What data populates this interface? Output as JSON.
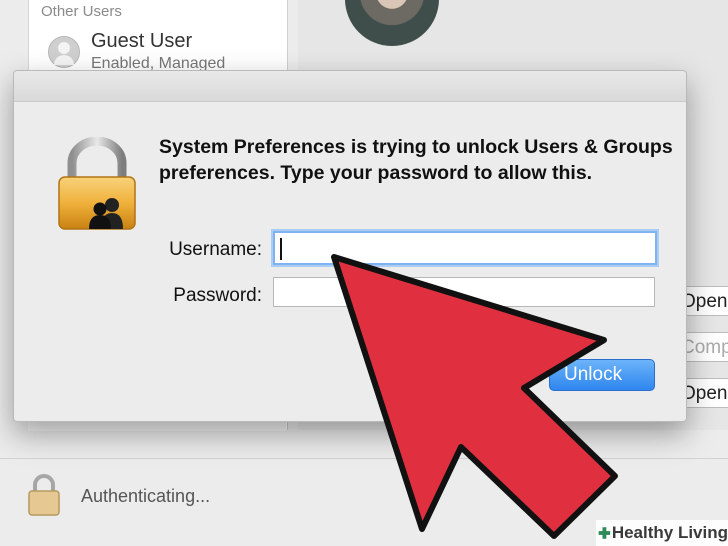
{
  "sidebar": {
    "section_header": "Other Users",
    "guest_user": {
      "name": "Guest User",
      "status": "Enabled, Managed"
    }
  },
  "right_panel": {
    "buttons": [
      {
        "label": "Open",
        "state": "normal"
      },
      {
        "label": "Computer",
        "state": "disabled"
      },
      {
        "label": "Open Pa",
        "state": "normal"
      }
    ]
  },
  "status_bar": {
    "text": "Authenticating...",
    "icon": "lock-icon"
  },
  "dialog": {
    "icon": "padlock-users-icon",
    "message": "System Preferences is trying to unlock Users & Groups preferences. Type your password to allow this.",
    "username_label": "Username:",
    "username_value": "",
    "password_label": "Password:",
    "password_value": "",
    "unlock_label": "Unlock"
  },
  "overlay": {
    "arrow_color": "#e0303f",
    "arrow_outline": "#111111"
  },
  "watermark": {
    "text": "Healthy Living"
  }
}
